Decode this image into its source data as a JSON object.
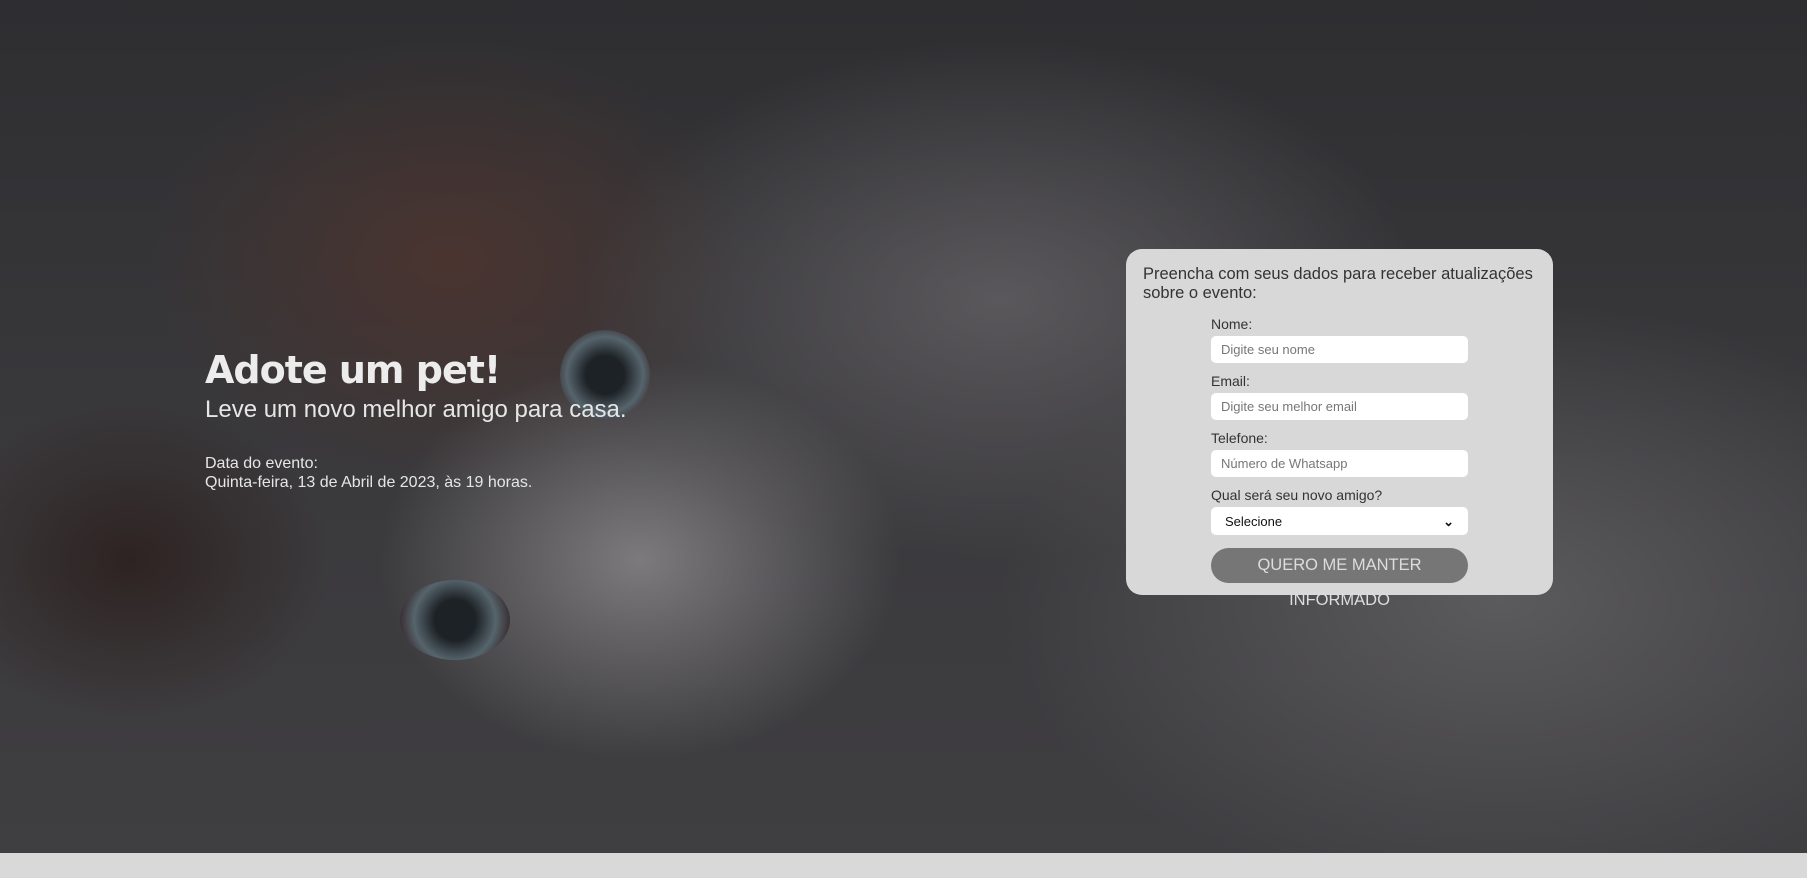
{
  "hero": {
    "title": "Adote um pet!",
    "subtitle": "Leve um novo melhor amigo para casa.",
    "date_label": "Data do evento:",
    "date_value": "Quinta-feira, 13 de Abril de 2023, às 19 horas."
  },
  "form": {
    "intro": "Preencha com seus dados para receber atualizações sobre o evento:",
    "name_label": "Nome:",
    "name_placeholder": "Digite seu nome",
    "email_label": "Email:",
    "email_placeholder": "Digite seu melhor email",
    "phone_label": "Telefone:",
    "phone_placeholder": "Número de Whatsapp",
    "pet_label": "Qual será seu novo amigo?",
    "pet_selected": "Selecione",
    "submit": "QUERO ME MANTER INFORMADO"
  }
}
